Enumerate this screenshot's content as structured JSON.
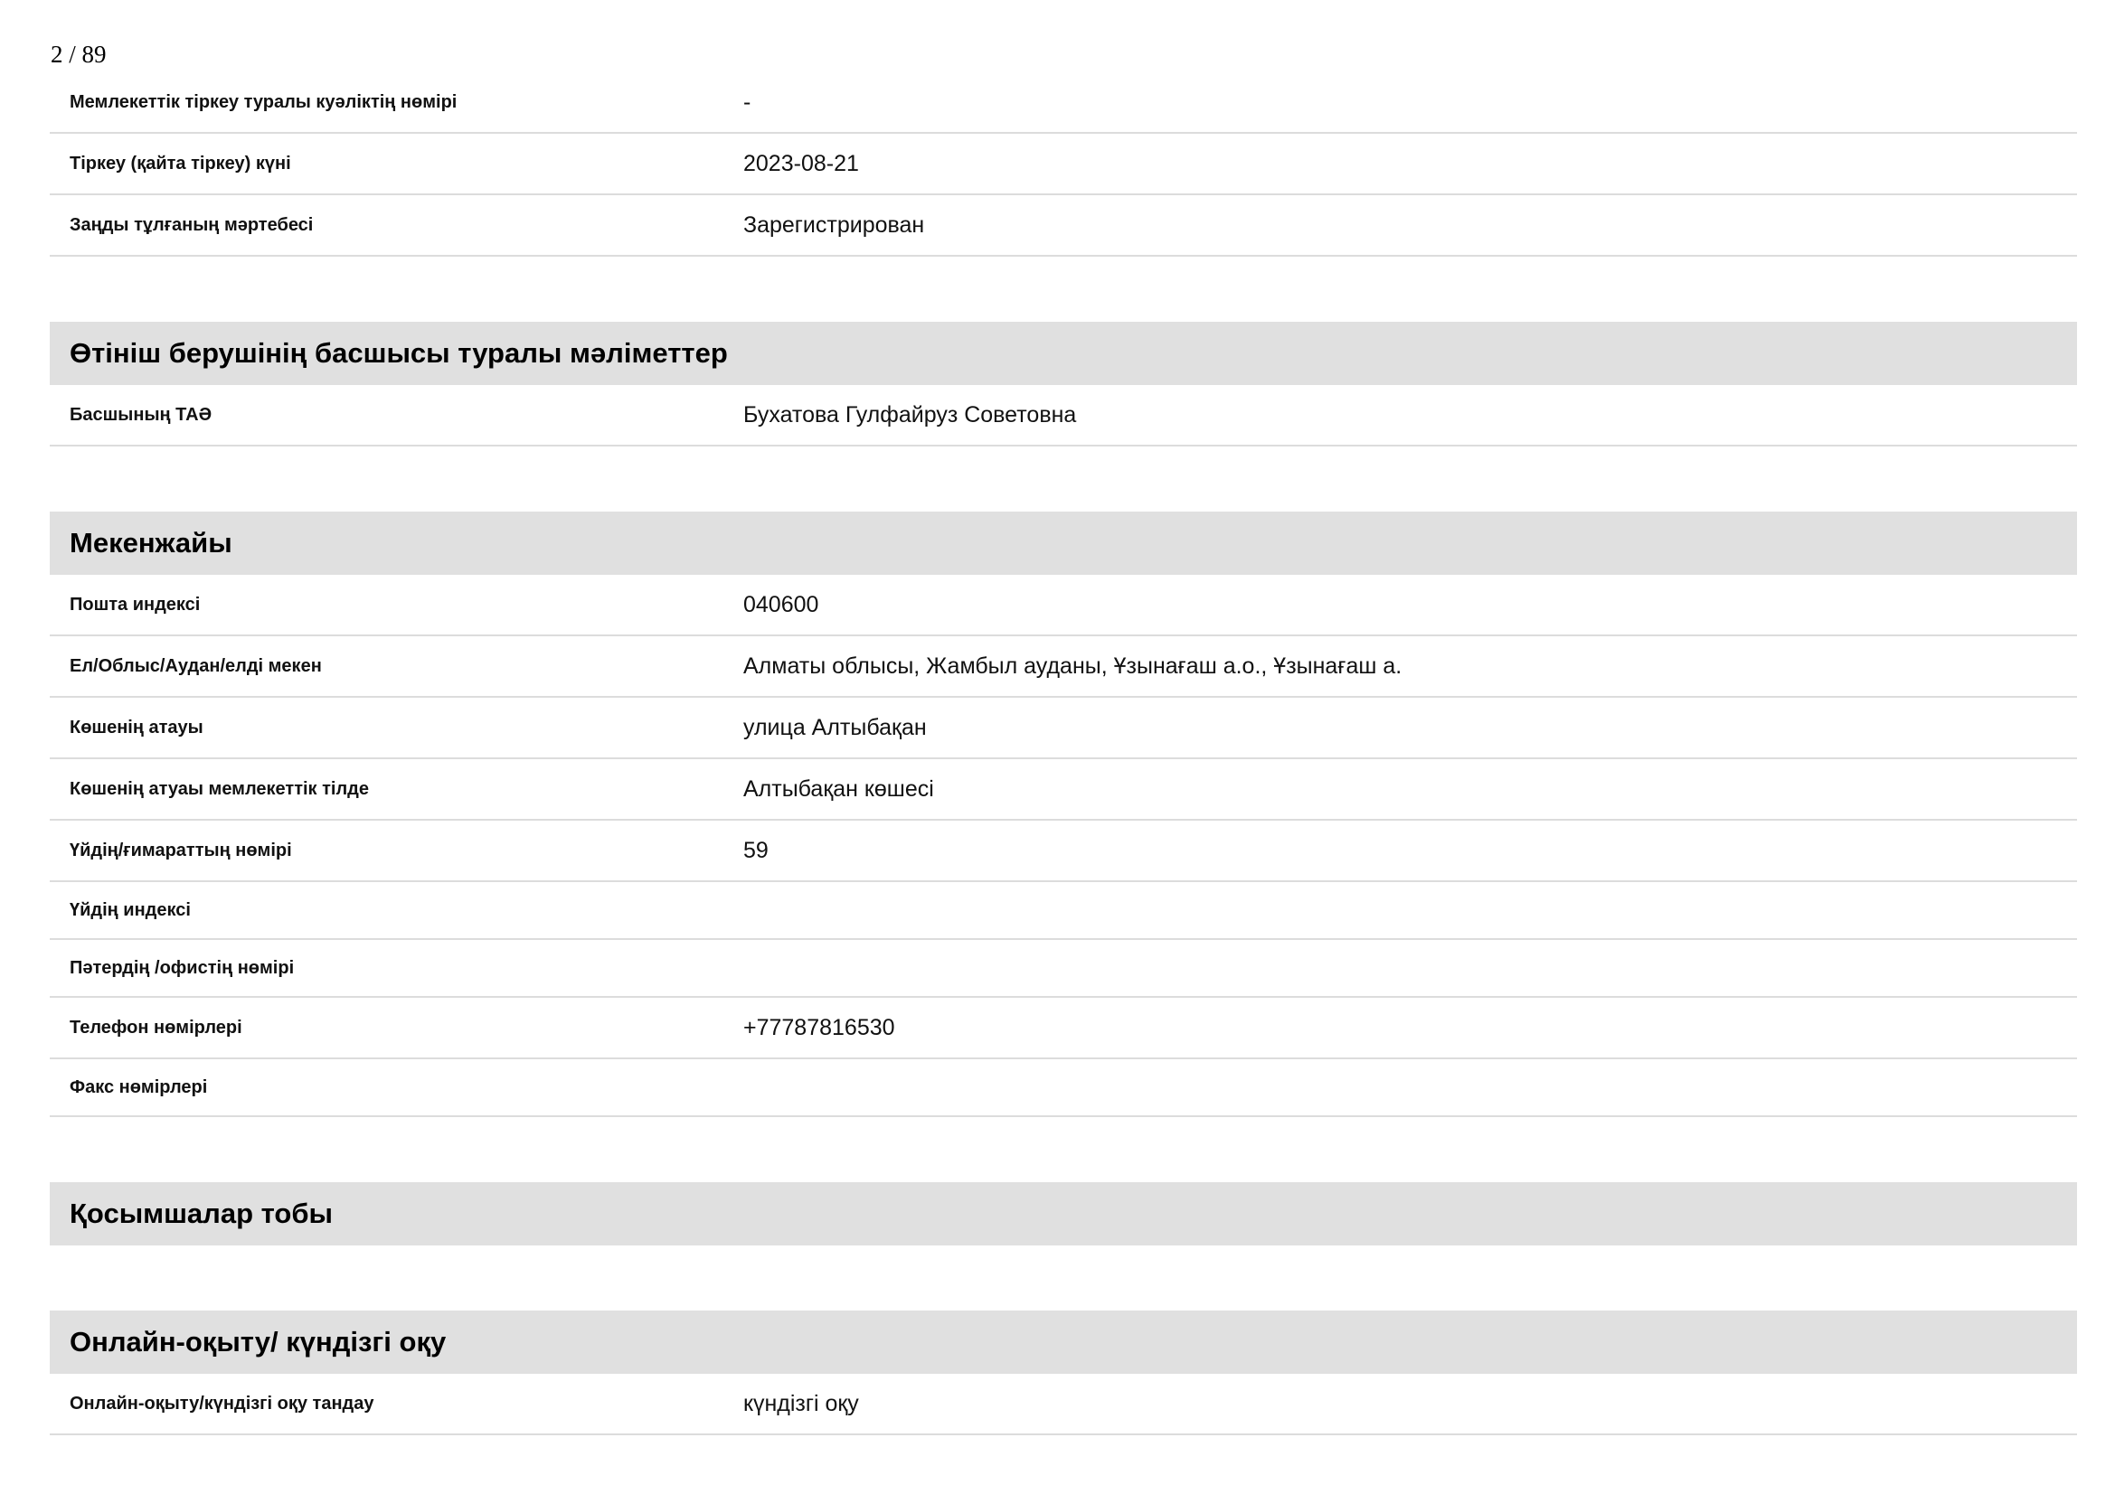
{
  "page_number": "2 / 89",
  "top_rows": [
    {
      "label": "Мемлекеттік тіркеу туралы куәліктің нөмірі",
      "value": "-"
    },
    {
      "label": "Тіркеу (қайта тіркеу) күні",
      "value": "2023-08-21"
    },
    {
      "label": "Заңды тұлғаның мәртебесі",
      "value": "Зарегистрирован"
    }
  ],
  "head_section": {
    "title": "Өтініш берушінің басшысы туралы мәліметтер",
    "rows": [
      {
        "label": "Басшының ТАӘ",
        "value": "Бухатова Гулфайруз Советовна"
      }
    ]
  },
  "address_section": {
    "title": "Мекенжайы",
    "rows": [
      {
        "label": "Пошта индексі",
        "value": "040600"
      },
      {
        "label": "Ел/Облыс/Аудан/елді мекен",
        "value": "Алматы облысы, Жамбыл ауданы, Ұзынағаш а.о., Ұзынағаш а."
      },
      {
        "label": "Көшенің атауы",
        "value": "улица Алтыбақан"
      },
      {
        "label": "Көшенің атуаы мемлекеттік тілде",
        "value": "Алтыбақан көшесі"
      },
      {
        "label": "Үйдің/ғимараттың нөмірі",
        "value": "59"
      },
      {
        "label": "Үйдің индексі",
        "value": ""
      },
      {
        "label": "Пәтердің /офистің нөмірі",
        "value": ""
      },
      {
        "label": "Телефон нөмірлері",
        "value": "+77787816530"
      },
      {
        "label": "Факс нөмірлері",
        "value": ""
      }
    ]
  },
  "attachments_section": {
    "title": "Қосымшалар тобы"
  },
  "online_section": {
    "title": "Онлайн-оқыту/ күндізгі оқу",
    "rows": [
      {
        "label": "Онлайн-оқыту/күндізгі оқу тандау",
        "value": "күндізгі оқу"
      }
    ]
  }
}
